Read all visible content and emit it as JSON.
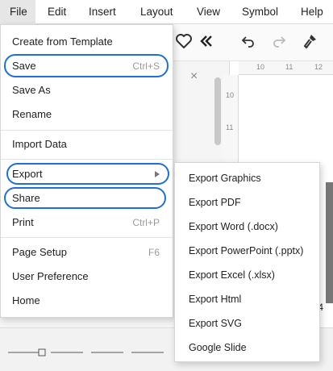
{
  "menubar": {
    "items": [
      {
        "label": "File",
        "active": true
      },
      {
        "label": "Edit"
      },
      {
        "label": "Insert"
      },
      {
        "label": "Layout"
      },
      {
        "label": "View"
      },
      {
        "label": "Symbol"
      },
      {
        "label": "Help"
      }
    ]
  },
  "toolbar": {
    "icons": [
      "heart-icon",
      "double-chevron-left-icon",
      "undo-icon",
      "redo-icon",
      "format-painter-icon"
    ]
  },
  "ruler": {
    "top_labels": [
      "10",
      "11",
      "12"
    ],
    "left_labels": [
      "10",
      "11"
    ]
  },
  "side_panel": {
    "close_glyph": "×"
  },
  "canvas": {
    "size_fragment": "x 4"
  },
  "file_menu": {
    "items": [
      {
        "label": "Create from Template",
        "shortcut": ""
      },
      {
        "label": "Save",
        "shortcut": "Ctrl+S"
      },
      {
        "label": "Save As",
        "shortcut": ""
      },
      {
        "label": "Rename",
        "shortcut": ""
      },
      {
        "label": "Import Data",
        "shortcut": ""
      },
      {
        "label": "Export",
        "shortcut": "",
        "has_submenu": true
      },
      {
        "label": "Share",
        "shortcut": ""
      },
      {
        "label": "Print",
        "shortcut": "Ctrl+P"
      },
      {
        "label": "Page Setup",
        "shortcut": "F6"
      },
      {
        "label": "User Preference",
        "shortcut": ""
      },
      {
        "label": "Home",
        "shortcut": ""
      }
    ]
  },
  "export_submenu": {
    "items": [
      {
        "label": "Export Graphics"
      },
      {
        "label": "Export PDF"
      },
      {
        "label": "Export Word (.docx)"
      },
      {
        "label": "Export PowerPoint (.pptx)"
      },
      {
        "label": "Export Excel (.xlsx)"
      },
      {
        "label": "Export Html"
      },
      {
        "label": "Export SVG"
      },
      {
        "label": "Google Slide"
      }
    ]
  },
  "colors": {
    "highlight_ring": "#1e6fd9",
    "menu_active_bg": "#e6e6e6"
  }
}
